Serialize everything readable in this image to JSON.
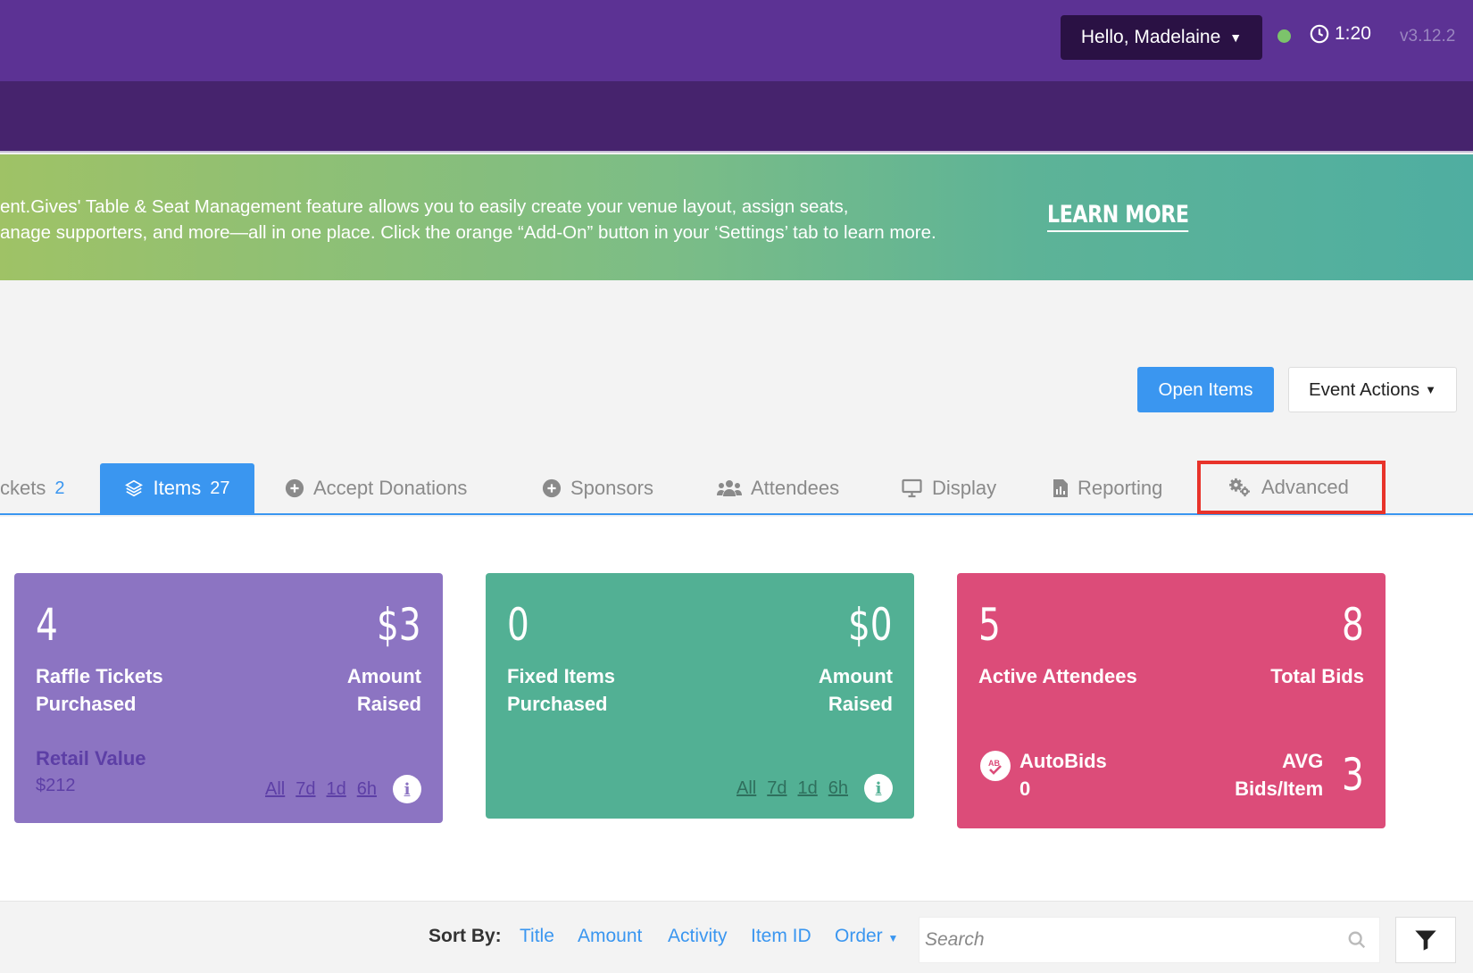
{
  "header": {
    "greeting": "Hello,  Madelaine",
    "clock_time": "1:20",
    "version": "v3.12.2",
    "status_color": "#7cc36b"
  },
  "banner": {
    "line1": "ent.Gives' Table & Seat Management feature allows you to easily create your venue layout, assign seats,",
    "line2": "anage supporters, and more—all in one place. Click the orange “Add-On” button in your ‘Settings’ tab to learn more.",
    "cta": "LEARN MORE"
  },
  "actions": {
    "open_items": "Open Items",
    "event_actions": "Event Actions"
  },
  "tabs": [
    {
      "label": "ckets",
      "count": "2",
      "icon": "ticket-icon"
    },
    {
      "label": "Items",
      "count": "27",
      "icon": "layers-icon",
      "active": true
    },
    {
      "label": "Accept Donations",
      "icon": "plus-circle-icon"
    },
    {
      "label": "Sponsors",
      "icon": "plus-circle-icon"
    },
    {
      "label": "Attendees",
      "icon": "users-icon"
    },
    {
      "label": "Display",
      "icon": "monitor-icon"
    },
    {
      "label": "Reporting",
      "icon": "report-file-icon"
    },
    {
      "label": "Advanced",
      "icon": "gears-icon",
      "highlighted": true
    }
  ],
  "cards": {
    "raffle": {
      "count": "4",
      "count_label": "Raffle Tickets Purchased",
      "amount": "$3",
      "amount_label": "Amount Raised",
      "retail_label": "Retail Value",
      "retail_value": "$212",
      "ranges": [
        "All",
        "7d",
        "1d",
        "6h"
      ],
      "color": "#8c74c2"
    },
    "fixed": {
      "count": "0",
      "count_label": "Fixed Items Purchased",
      "amount": "$0",
      "amount_label": "Amount Raised",
      "ranges": [
        "All",
        "7d",
        "1d",
        "6h"
      ],
      "color": "#52b094"
    },
    "attendees": {
      "count": "5",
      "count_label": "Active Attendees",
      "bids": "8",
      "bids_label": "Total Bids",
      "autobids_label": "AutoBids",
      "autobids_value": "0",
      "avg_label": "AVG Bids/Item",
      "avg_value": "3",
      "autobid_icon_text": "AB",
      "color": "#dc4c79"
    }
  },
  "sort": {
    "label": "Sort By:",
    "options": [
      "Title",
      "Amount",
      "Activity",
      "Item ID",
      "Order"
    ],
    "search_placeholder": "Search"
  }
}
